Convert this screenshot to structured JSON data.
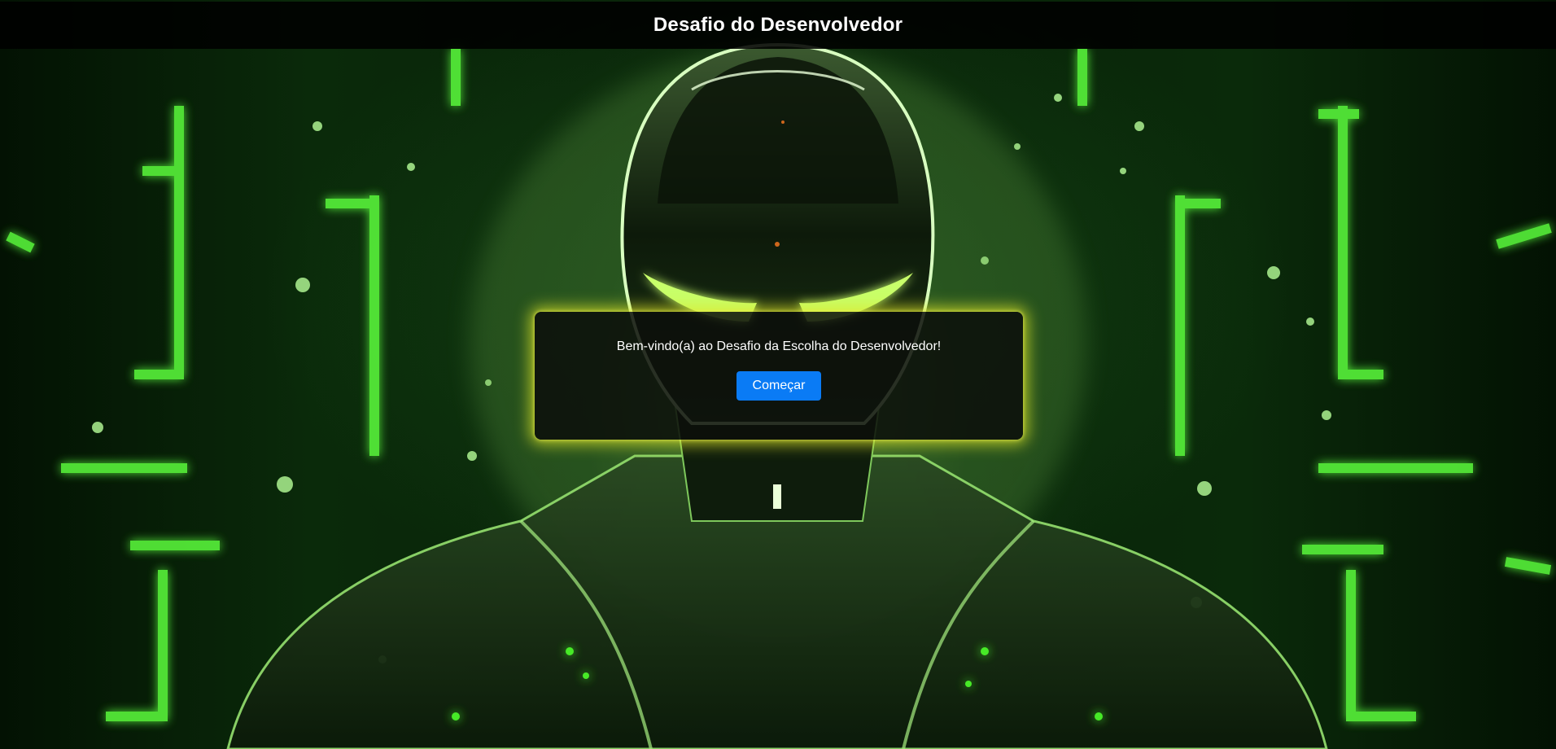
{
  "header": {
    "title": "Desafio do Desenvolvedor"
  },
  "welcome_dialog": {
    "message": "Bem-vindo(a) ao Desafio da Escolha do Desenvolvedor!",
    "start_button_label": "Começar"
  },
  "colors": {
    "header_bg": "#000000",
    "dialog_bg": "#0c0e0a",
    "dialog_glow": "#dce628",
    "button_bg": "#0a7bf5",
    "background_accent": "#5cff3c"
  }
}
